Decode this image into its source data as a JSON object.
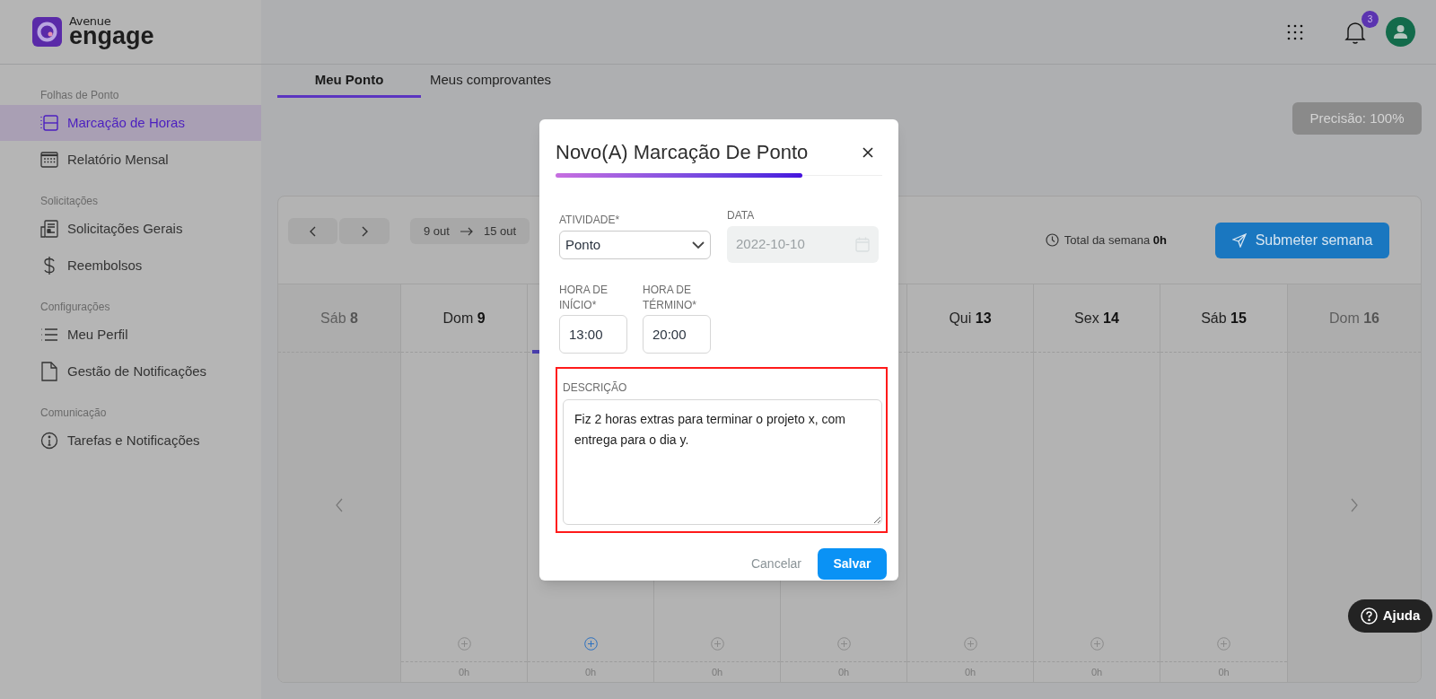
{
  "header": {
    "logo_small": "Avenue",
    "logo_large": "engage",
    "notification_count": "3"
  },
  "sidebar": {
    "sections": [
      {
        "title": "Folhas de Ponto",
        "items": [
          {
            "label": "Marcação de Horas",
            "selected": true
          },
          {
            "label": "Relatório Mensal",
            "selected": false
          }
        ]
      },
      {
        "title": "Solicitações",
        "items": [
          {
            "label": "Solicitações Gerais",
            "selected": false
          },
          {
            "label": "Reembolsos",
            "selected": false
          }
        ]
      },
      {
        "title": "Configurações",
        "items": [
          {
            "label": "Meu Perfil",
            "selected": false
          },
          {
            "label": "Gestão de Notificações",
            "selected": false
          }
        ]
      },
      {
        "title": "Comunicação",
        "items": [
          {
            "label": "Tarefas e Notificações",
            "selected": false
          }
        ]
      }
    ]
  },
  "tabs": [
    {
      "label": "Meu Ponto",
      "selected": true
    },
    {
      "label": "Meus comprovantes",
      "selected": false
    }
  ],
  "precision_button": "Precisão: 100%",
  "week": {
    "range_start": "9 out",
    "range_end": "15 out",
    "total": "Total da semana **0h**",
    "submit_button": "Submeter semana",
    "days": [
      {
        "weekday": "Sáb",
        "day": "8",
        "in_week": false
      },
      {
        "weekday": "Dom",
        "day": "9",
        "in_week": true,
        "today": false,
        "hours": "0h"
      },
      {
        "in_week": true,
        "today": true,
        "hours": "0h"
      },
      {
        "in_week": true,
        "today": false,
        "hours": "0h"
      },
      {
        "in_week": true,
        "today": false,
        "hours": "0h"
      },
      {
        "weekday": "Qui",
        "day": "13",
        "in_week": true,
        "today": false,
        "hours": "0h"
      },
      {
        "weekday": "Sex",
        "day": "14",
        "in_week": true,
        "today": false,
        "hours": "0h"
      },
      {
        "weekday": "Sáb",
        "day": "15",
        "in_week": true,
        "today": false,
        "hours": "0h"
      },
      {
        "weekday": "Dom",
        "day": "16",
        "in_week": false
      }
    ]
  },
  "modal": {
    "title": "Novo(A) Marcação De Ponto",
    "activity": {
      "label": "ATIVIDADE*",
      "value": "Ponto"
    },
    "date": {
      "label": "DATA",
      "value": "2022-10-10",
      "disabled": true
    },
    "start_time": {
      "label": "HORA DE INÍCIO*",
      "value": "13:00"
    },
    "end_time": {
      "label": "HORA DE TÉRMINO*",
      "value": "20:00"
    },
    "description": {
      "label": "DESCRIÇÃO",
      "value": "Fiz 2 horas extras para terminar o projeto x, com entrega para o dia y.",
      "highlighted": true
    },
    "cancel_button": "Cancelar",
    "save_button": "Salvar"
  },
  "help_button": "Ajuda"
}
